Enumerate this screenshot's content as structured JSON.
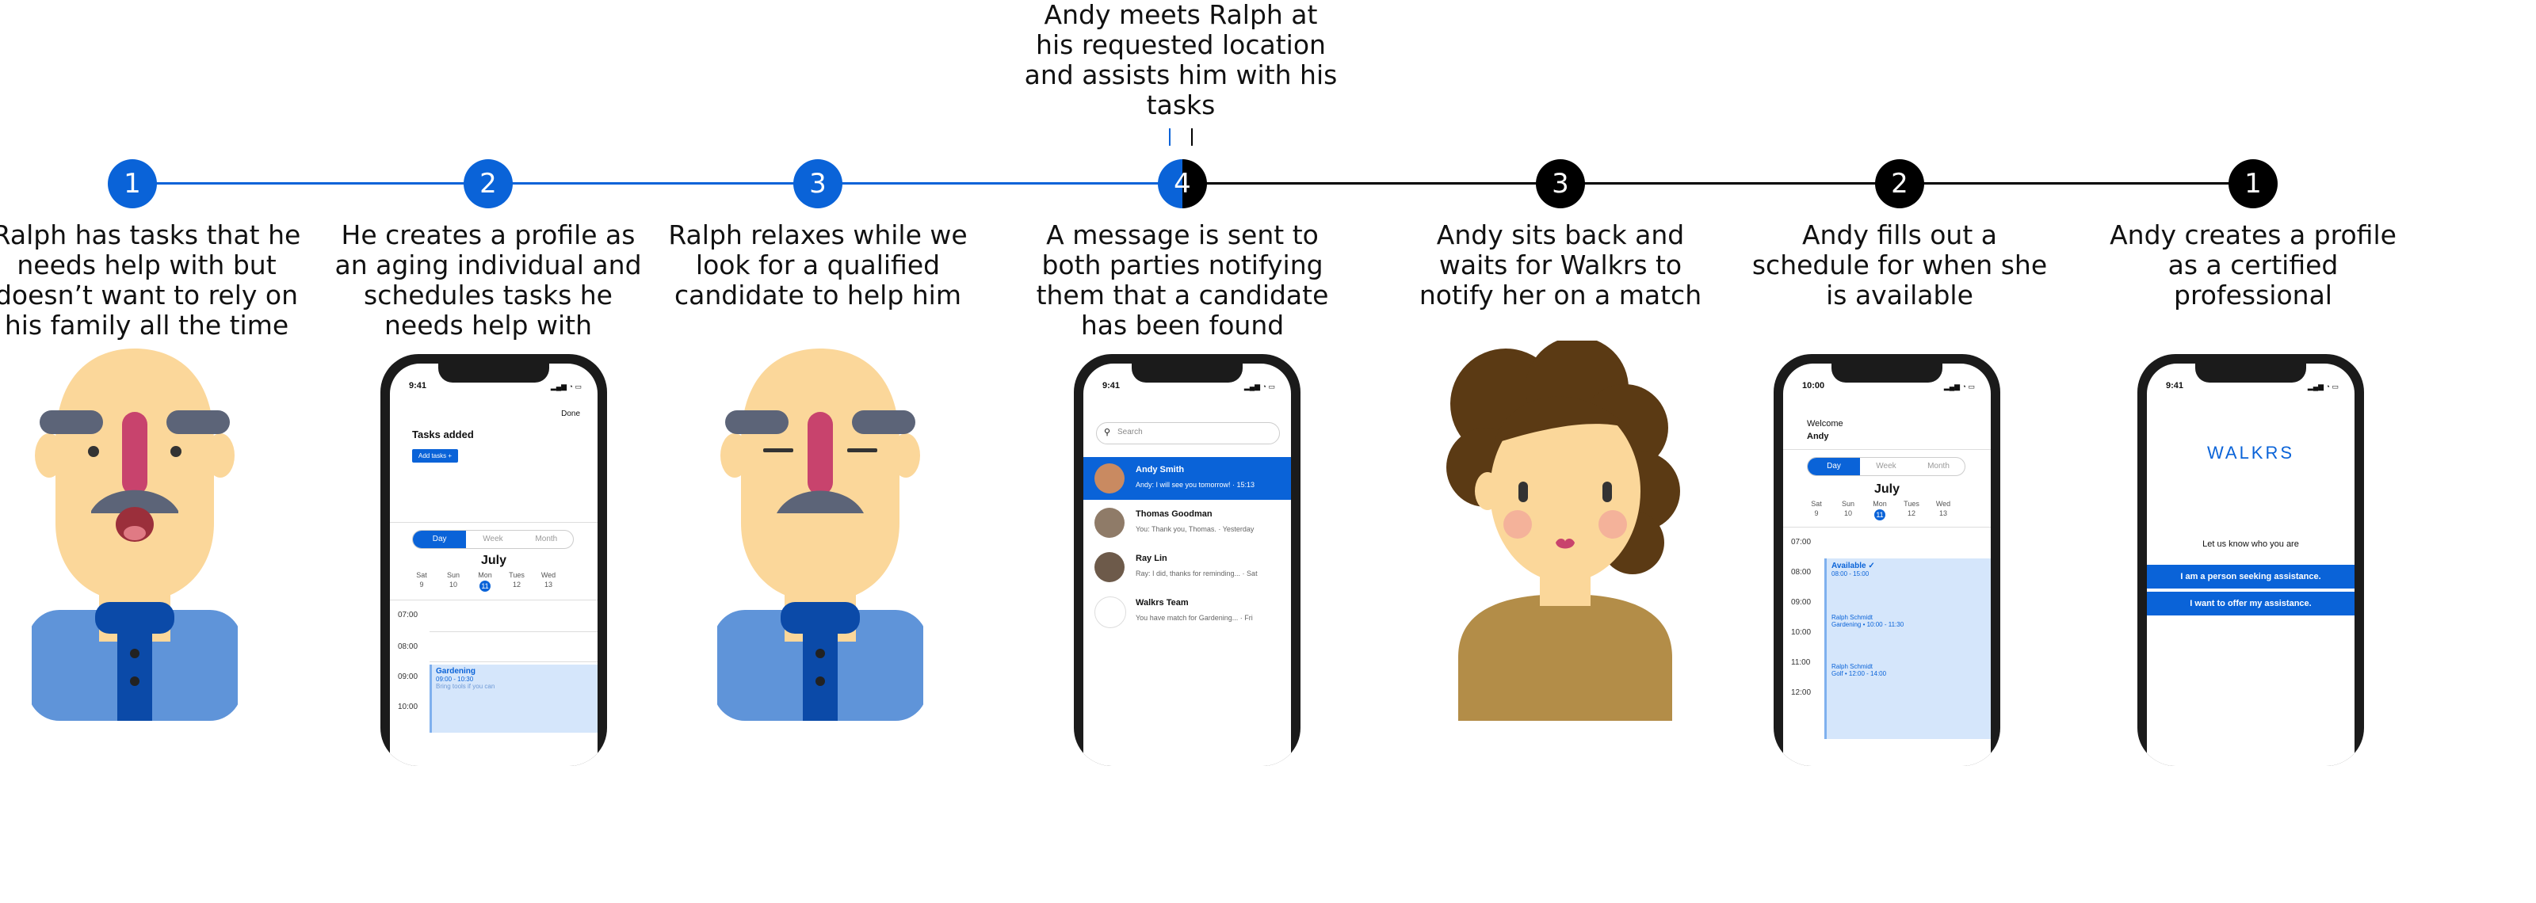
{
  "top_caption": "Andy meets Ralph at his requested location and assists him with his tasks",
  "colors": {
    "ralph_path": "#0a63d8",
    "andy_path": "#000000"
  },
  "steps": [
    {
      "number": "1",
      "caption": "Ralph has tasks that he needs help with but doesn’t want to rely on his family all the time"
    },
    {
      "number": "2",
      "caption": "He creates a profile as an aging individual and schedules tasks he needs help with"
    },
    {
      "number": "3",
      "caption": "Ralph relaxes while we look for a qualified candidate to help him"
    },
    {
      "number": "4",
      "caption": "A message is sent to both parties notifying them that a candidate has been found"
    },
    {
      "number": "3",
      "caption": "Andy sits back and waits for Walkrs to notify her on a match"
    },
    {
      "number": "2",
      "caption": "Andy fills out a schedule for when she is available"
    },
    {
      "number": "1",
      "caption": "Andy creates a profile as a certified professional"
    }
  ],
  "phone_tasks": {
    "time": "9:41",
    "done": "Done",
    "title": "Tasks added",
    "add_button": "Add tasks +",
    "tabs": [
      "Day",
      "Week",
      "Month"
    ],
    "month": "July",
    "days": [
      {
        "d": "Sat",
        "n": "9"
      },
      {
        "d": "Sun",
        "n": "10"
      },
      {
        "d": "Mon",
        "n": "11"
      },
      {
        "d": "Tues",
        "n": "12"
      },
      {
        "d": "Wed",
        "n": "13"
      }
    ],
    "hours": [
      "07:00",
      "08:00",
      "09:00",
      "10:00"
    ],
    "event_title": "Gardening",
    "event_time": "09:00 - 10:30",
    "event_note": "Bring tools if you can"
  },
  "phone_messages": {
    "time": "9:41",
    "search_placeholder": "Search",
    "threads": [
      {
        "name": "Andy Smith",
        "preview": "Andy: I will see you tomorrow! · 15:13"
      },
      {
        "name": "Thomas Goodman",
        "preview": "You: Thank you, Thomas. · Yesterday"
      },
      {
        "name": "Ray Lin",
        "preview": "Ray: I did, thanks for reminding... · Sat"
      },
      {
        "name": "Walkrs Team",
        "preview": "You have match for Gardening... · Fri"
      }
    ]
  },
  "phone_schedule": {
    "time": "10:00",
    "welcome": "Welcome",
    "user": "Andy",
    "tabs": [
      "Day",
      "Week",
      "Month"
    ],
    "month": "July",
    "days": [
      {
        "d": "Sat",
        "n": "9"
      },
      {
        "d": "Sun",
        "n": "10"
      },
      {
        "d": "Mon",
        "n": "11"
      },
      {
        "d": "Tues",
        "n": "12"
      },
      {
        "d": "Wed",
        "n": "13"
      }
    ],
    "hours": [
      "07:00",
      "08:00",
      "09:00",
      "10:00",
      "11:00",
      "12:00"
    ],
    "available": "Available ✓",
    "available_time": "08:00 - 15:00",
    "event1_name": "Ralph Schmidt",
    "event1_detail": "Gardening • 10:00 - 11:30",
    "event2_name": "Ralph Schmidt",
    "event2_detail": "Golf • 12:00 - 14:00"
  },
  "phone_welcome": {
    "time": "9:41",
    "logo": "WALKRS",
    "prompt": "Let us know who you are",
    "option_1": "I am a person seeking assistance.",
    "option_2": "I want to offer my assistance."
  }
}
